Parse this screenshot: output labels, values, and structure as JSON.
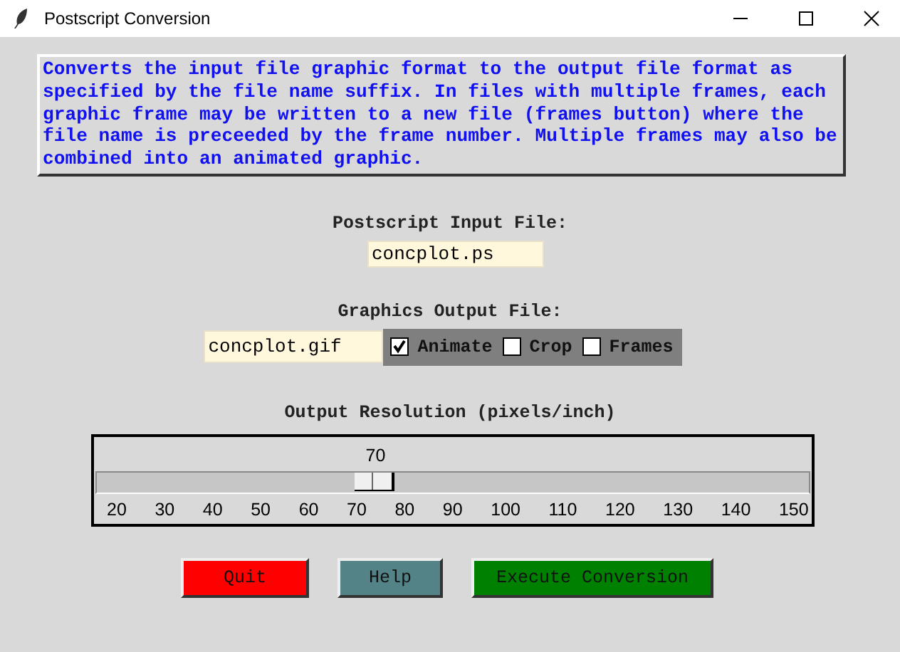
{
  "window": {
    "title": "Postscript Conversion"
  },
  "description": "Converts the input file graphic format to the output file format as specified by the file name suffix. In files with multiple frames, each graphic frame may be written to a new file (frames button) where the file name is preceeded by the frame number. Multiple frames may also be combined into an animated graphic.",
  "input": {
    "label": "Postscript Input File:",
    "value": "concplot.ps"
  },
  "output": {
    "label": "Graphics Output File:",
    "value": "concplot.gif"
  },
  "options": [
    {
      "label": "Animate",
      "checked": true
    },
    {
      "label": "Crop",
      "checked": false
    },
    {
      "label": "Frames",
      "checked": false
    }
  ],
  "resolution": {
    "label": "Output Resolution (pixels/inch)",
    "reading": "70",
    "level": 0.385,
    "ticks": [
      "20",
      "30",
      "40",
      "50",
      "60",
      "70",
      "80",
      "90",
      "100",
      "110",
      "120",
      "130",
      "140",
      "150"
    ]
  },
  "buttons": [
    {
      "label": "Quit",
      "kind": "quit"
    },
    {
      "label": "Help",
      "kind": "help"
    },
    {
      "label": "Execute Conversion",
      "kind": "execute"
    }
  ]
}
